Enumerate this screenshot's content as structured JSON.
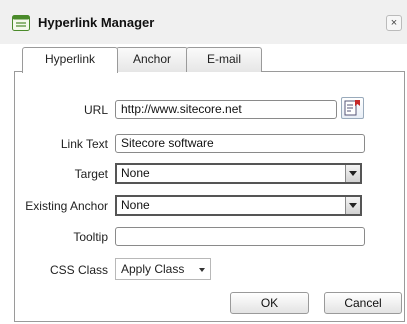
{
  "window": {
    "title": "Hyperlink Manager",
    "close_glyph": "×"
  },
  "tabs": [
    {
      "label": "Hyperlink",
      "active": true
    },
    {
      "label": "Anchor",
      "active": false
    },
    {
      "label": "E-mail",
      "active": false
    }
  ],
  "form": {
    "url_label": "URL",
    "url_value": "http://www.sitecore.net",
    "link_text_label": "Link Text",
    "link_text_value": "Sitecore software",
    "target_label": "Target",
    "target_value": "None",
    "existing_anchor_label": "Existing Anchor",
    "existing_anchor_value": "None",
    "tooltip_label": "Tooltip",
    "tooltip_value": "",
    "css_class_label": "CSS Class",
    "css_class_value": "Apply Class"
  },
  "buttons": {
    "ok": "OK",
    "cancel": "Cancel"
  },
  "icons": {
    "title": "document-list-icon",
    "browse": "document-browse-icon"
  }
}
